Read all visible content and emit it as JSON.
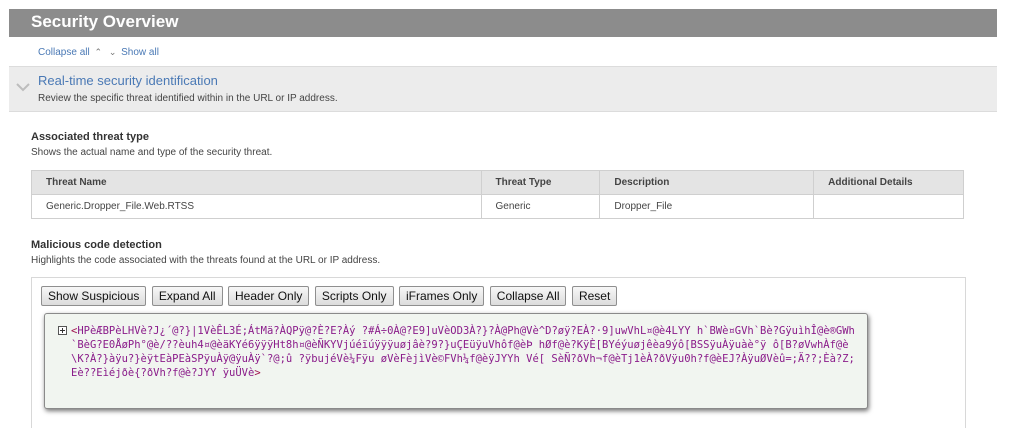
{
  "page": {
    "title": "Security Overview",
    "collapse_all": "Collapse all",
    "show_all": "Show all"
  },
  "section": {
    "title": "Real-time security identification",
    "description": "Review the specific threat identified within in the URL or IP address."
  },
  "threat_type": {
    "title": "Associated threat type",
    "description": "Shows the actual name and type of the security threat.",
    "columns": [
      "Threat Name",
      "Threat Type",
      "Description",
      "Additional Details"
    ],
    "rows": [
      [
        "Generic.Dropper_File.Web.RTSS",
        "Generic",
        "Dropper_File",
        ""
      ]
    ]
  },
  "malicious_code": {
    "title": "Malicious code detection",
    "description": "Highlights the code associated with the threats found at the URL or IP address.",
    "buttons": [
      "Show Suspicious",
      "Expand All",
      "Header Only",
      "Scripts Only",
      "iFrames Only",
      "Collapse All",
      "Reset"
    ],
    "code_open": "<",
    "code_text": "HPèÆBPèLHVè?J¿´@?}|1VèÊL3É;ÁtMä?ÀQPÿ@?È?E?Àý ?#Á÷0À@?E9]uVèOD3À?}?À@Ph@Vè^D?øÿ?EÀ?·9]uwVhL¤@è4LYY h`BWè¤GVh`Bè?GÿuìhÎ@è®GWh`BèG?E0ÅøPh°@è/??èuh4¤@èäKYé6ÿÿÿHt8h¤@èÑKYVjúéïúÿÿÿuøjâè?9?}uÇEüÿuVhôf@èÞ hØf@è?KÿÈ[BYéýuøjêèa9ýô[BSSÿuÀÿuàè°ÿ ô[B?øVwhÀf@è\\K?À?}àÿu?}èÿtEàPEàSPÿuÀÿ@ÿuÀÿ`?@;û ?ÿbujéVè¼Fÿu øVèFèjìVè©FVh¼f@èÿJYYh Vé[ SèÑ?ðVh¬f@èTj1èÀ?ðVÿu0h?f@èEJ?ÀÿuØVèû=;Ä??;Èà?Z;Eè??Eìéjðè{?ðVh?f@è?JYY ÿuÜVè",
    "code_close": ">"
  },
  "colors": {
    "title_bar": "#8c8c8c",
    "link": "#4a79b5",
    "code_text": "#8a1c8a",
    "code_bg": "#f1f5f0"
  },
  "icons": [
    "chevron-up-icon",
    "chevron-down-icon",
    "expand-plus-icon"
  ]
}
